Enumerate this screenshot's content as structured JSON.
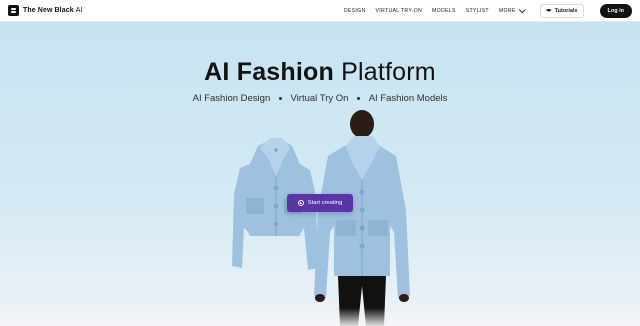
{
  "brand": {
    "name": "The New Black",
    "suffix": "AI"
  },
  "nav": {
    "links": [
      "DESIGN",
      "VIRTUAL TRY-ON",
      "MODELS",
      "STYLIST"
    ],
    "more_label": "MORE",
    "tutorials_label": "Tutorials",
    "login_label": "Log in"
  },
  "hero": {
    "title_bold": "AI Fashion",
    "title_regular": "Platform",
    "subtitle_items": [
      "AI Fashion Design",
      "Virtual Try On",
      "AI Fashion Models"
    ],
    "cta_label": "Start creating"
  },
  "colors": {
    "accent": "#5a35a6",
    "hero_top": "#c7e3f1",
    "jacket": "#9ec1e0",
    "jacket_shadow": "#7ea6c9",
    "dark": "#111111"
  },
  "icons": [
    "logo-mark",
    "chevron-down-icon",
    "graduation-cap-icon",
    "plus-circle-icon"
  ]
}
